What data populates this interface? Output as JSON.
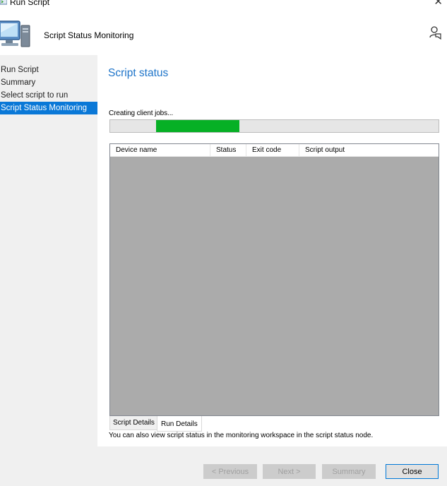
{
  "window": {
    "title": "Run Script",
    "close_glyph": "✕"
  },
  "header": {
    "title": "Script Status Monitoring",
    "icon": "computer-monitor-icon",
    "feedback_icon": "feedback-icon"
  },
  "sidebar": {
    "items": [
      {
        "label": "Run Script",
        "active": false
      },
      {
        "label": "Summary",
        "active": false
      },
      {
        "label": "Select script to run",
        "active": false
      },
      {
        "label": "Script Status Monitoring",
        "active": true
      }
    ]
  },
  "main": {
    "section_title": "Script status",
    "progress": {
      "label": "Creating client jobs...",
      "color": "#06b025"
    },
    "table": {
      "columns": [
        "Device name",
        "Status",
        "Exit code",
        "Script output"
      ],
      "rows": []
    },
    "tabs": [
      {
        "label": "Script Details",
        "selected": false
      },
      {
        "label": "Run Details",
        "selected": true
      }
    ],
    "info_text": "You can also view script status in the monitoring workspace in the script status node."
  },
  "footer": {
    "buttons": {
      "previous": "< Previous",
      "next": "Next >",
      "summary": "Summary",
      "close": "Close"
    }
  },
  "colors": {
    "accent": "#0a78d7",
    "heading": "#1e74c9",
    "grid_background": "#ababab"
  }
}
